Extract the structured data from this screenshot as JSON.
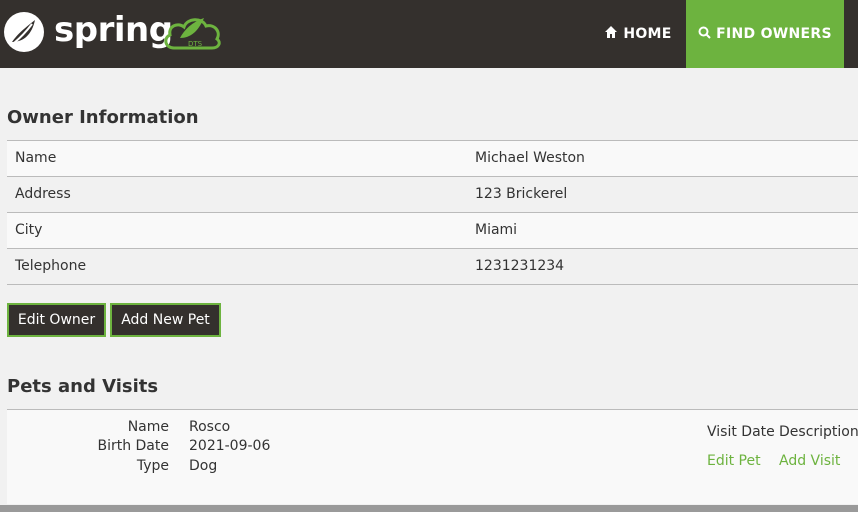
{
  "brand": {
    "logo_text": "spring",
    "cloud_text": "DTS"
  },
  "nav": {
    "home_label": "HOME",
    "home_icon": "home-icon",
    "find_label": "FIND OWNERS",
    "find_icon": "search-icon"
  },
  "colors": {
    "navbar": "#34302d",
    "accent": "#6db33f",
    "background": "#f1f1f1"
  },
  "owner": {
    "heading": "Owner Information",
    "rows": [
      {
        "label": "Name",
        "value": "Michael Weston"
      },
      {
        "label": "Address",
        "value": "123 Brickerel"
      },
      {
        "label": "City",
        "value": "Miami"
      },
      {
        "label": "Telephone",
        "value": "1231231234"
      }
    ],
    "edit_button": "Edit Owner",
    "add_pet_button": "Add New Pet"
  },
  "pets": {
    "heading": "Pets and Visits",
    "list": [
      {
        "name_label": "Name",
        "name": "Rosco",
        "birth_label": "Birth Date",
        "birth_date": "2021-09-06",
        "type_label": "Type",
        "type": "Dog"
      }
    ],
    "visit_date_header": "Visit Date",
    "description_header": "Description",
    "edit_pet_link": "Edit Pet",
    "add_visit_link": "Add Visit"
  }
}
